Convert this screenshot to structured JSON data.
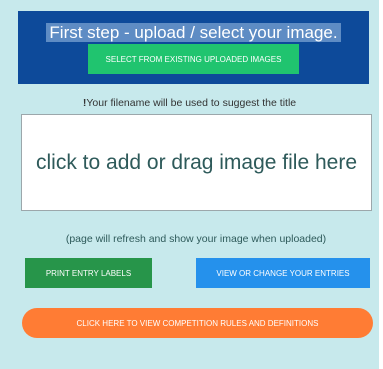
{
  "header": {
    "title": "First step - upload / select your image.",
    "select_button": "SELECT FROM EXISTING UPLOADED IMAGES"
  },
  "hint": {
    "mark": "!",
    "text": "Your filename will be used to suggest the title"
  },
  "dropzone": {
    "text": "click to add or drag image file here"
  },
  "refresh_note": "(page will refresh and show your image when uploaded)",
  "buttons": {
    "print": "PRINT ENTRY LABELS",
    "view": "VIEW OR CHANGE YOUR ENTRIES",
    "rules": "CLICK HERE TO VIEW COMPETITION RULES AND DEFINITIONS"
  },
  "colors": {
    "panel_bg": "#c7e9ec",
    "header_bg": "#0d4a9a",
    "select_button": "#20c46f",
    "print_button": "#27954a",
    "view_button": "#2591ec",
    "rules_button": "#ff7c34"
  }
}
